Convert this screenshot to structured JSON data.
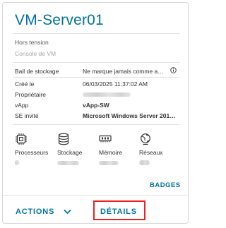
{
  "vm": {
    "name": "VM-Server01",
    "status": "Hors tension",
    "console_label": "Console de VM"
  },
  "properties": [
    {
      "label": "Bail de stockage",
      "value": "Ne marque jamais comme a…"
    },
    {
      "label": "Créé le",
      "value": "06/03/2025 11:37:02 AM"
    },
    {
      "label": "Propriétaire",
      "value": ""
    },
    {
      "label": "vApp",
      "value": "vApp-SW"
    },
    {
      "label": "SE invité",
      "value": "Microsoft Windows Server 201…"
    }
  ],
  "resources": [
    {
      "label": "Processeurs",
      "icon": "cpu-icon"
    },
    {
      "label": "Stockage",
      "icon": "storage-icon"
    },
    {
      "label": "Mémoire",
      "icon": "memory-icon"
    },
    {
      "label": "Réseaux",
      "icon": "network-icon"
    }
  ],
  "footer": {
    "badges_label": "BADGES",
    "actions_label": "ACTIONS",
    "details_label": "DÉTAILS"
  },
  "colors": {
    "accent": "#0072a3",
    "highlight": "#e8231f",
    "text": "#313131"
  }
}
